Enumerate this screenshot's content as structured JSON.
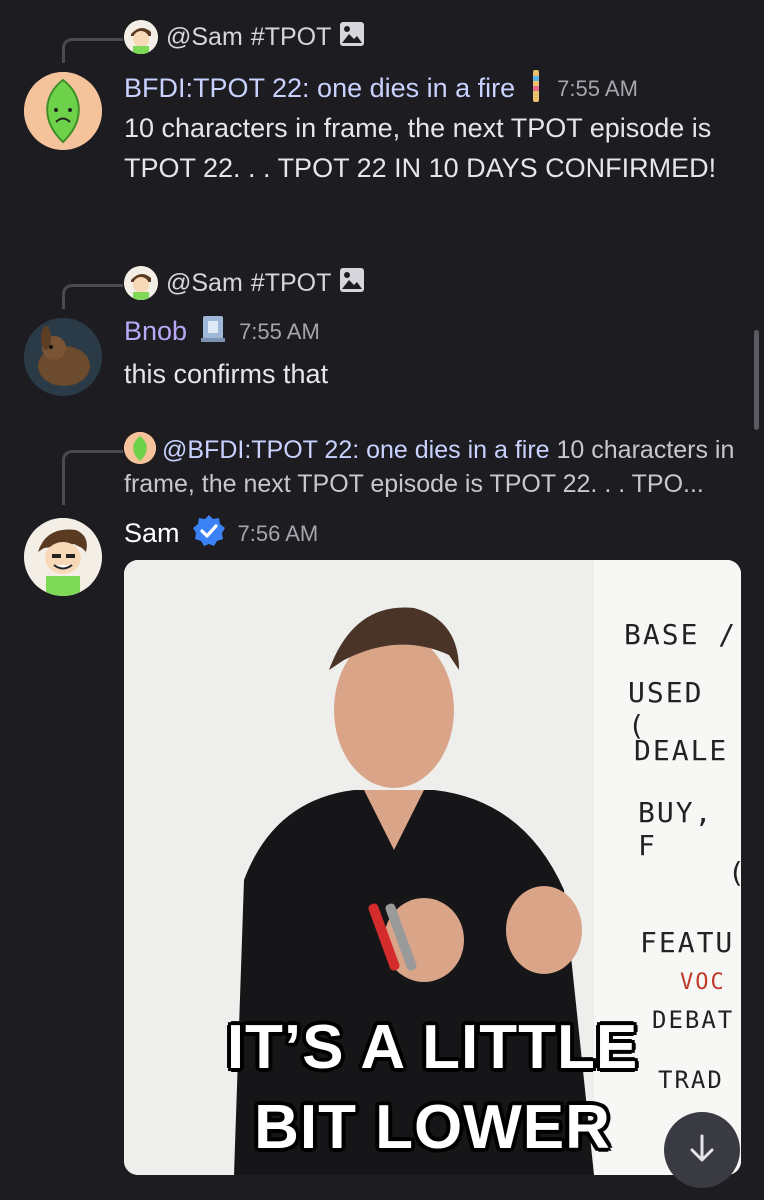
{
  "messages": [
    {
      "reply_to": {
        "name": "@Sam",
        "channel": "#TPOT"
      },
      "author": "BFDI:TPOT 22: one dies in a fire",
      "author_color": "#c9d2ff",
      "time": "7:55 AM",
      "text": "10 characters in frame, the next TPOT episode is TPOT 22. . . TPOT 22 IN 10 DAYS CONFIRMED!"
    },
    {
      "reply_to": {
        "name": "@Sam",
        "channel": "#TPOT"
      },
      "author": "Bnob",
      "author_color": "#b9a8f5",
      "time": "7:55 AM",
      "text": "this confirms that"
    },
    {
      "reply_to": {
        "name": "@BFDI:TPOT 22: one dies in a fire",
        "preview": " 10 characters in frame, the next TPOT episode is TPOT 22. . . TPO..."
      },
      "author": "Sam",
      "author_color": "#ffffff",
      "time": "7:56 AM",
      "gif": {
        "caption_line1": "IT’S A LITTLE",
        "caption_line2": "BIT LOWER",
        "board_lines": [
          "BASE /",
          "USED (",
          "DEALE",
          "BUY, F",
          "(",
          "FEATU",
          "VOC",
          "DEBAT",
          "TRAD"
        ]
      }
    }
  ],
  "icons": {
    "image": "image-icon",
    "verified": "verified-badge-icon",
    "scroll_down": "arrow-down-icon"
  },
  "colors": {
    "background": "#1c1c21",
    "verified": "#3b82f6",
    "mention": "#c9d2ff"
  }
}
